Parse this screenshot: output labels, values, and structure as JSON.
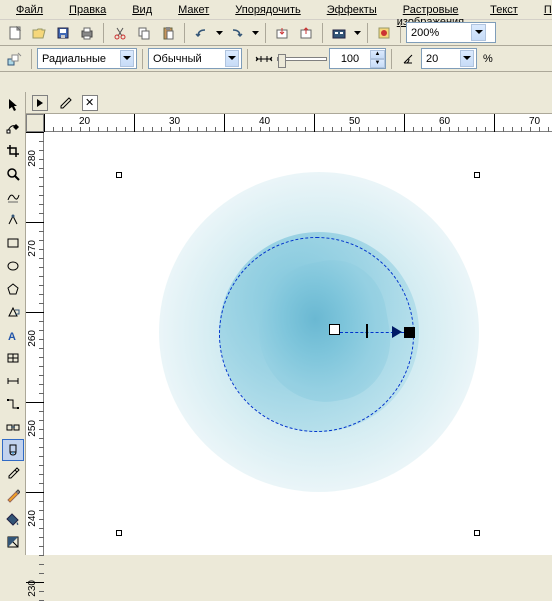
{
  "menu": {
    "file": "Файл",
    "edit": "Правка",
    "view": "Вид",
    "layout": "Макет",
    "arrange": "Упорядочить",
    "effects": "Эффекты",
    "bitmaps": "Растровые изображения",
    "text": "Текст",
    "partial": "П"
  },
  "toolbar": {
    "zoom_value": "200%"
  },
  "props": {
    "fill_type": "Радиальные",
    "blend_mode": "Обычный",
    "opacity_value": "100",
    "steps_value": "20"
  },
  "ruler_h": [
    "20",
    "30",
    "40",
    "50",
    "60",
    "70"
  ],
  "ruler_v": [
    "280",
    "270",
    "260",
    "250",
    "240",
    "230"
  ],
  "percent_label": "%",
  "colors": {
    "ui_bg": "#ece9d8",
    "selection": "#0033cc",
    "rose_core": "#7bc4da"
  }
}
